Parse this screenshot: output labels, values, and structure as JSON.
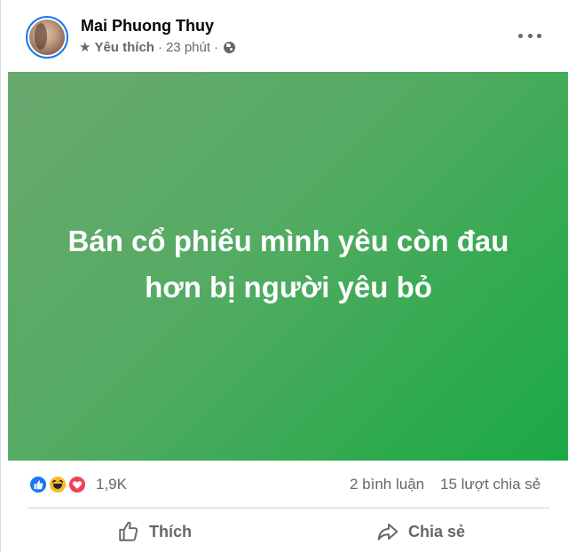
{
  "post": {
    "author": "Mai Phuong Thuy",
    "favorite_label": "Yêu thích",
    "time": "23 phút",
    "separator": "·",
    "text_line1": "Bán cổ phiếu mình yêu còn đau",
    "text_line2": "hơn bị người yêu bỏ",
    "reaction_count": "1,9K",
    "comments": "2 bình luận",
    "shares": "15 lượt chia sẻ",
    "like_label": "Thích",
    "share_label": "Chia sẻ",
    "background_start": "#6aa96f",
    "background_end": "#1ba944",
    "reactions": [
      "like-icon",
      "haha-icon",
      "love-icon"
    ]
  }
}
